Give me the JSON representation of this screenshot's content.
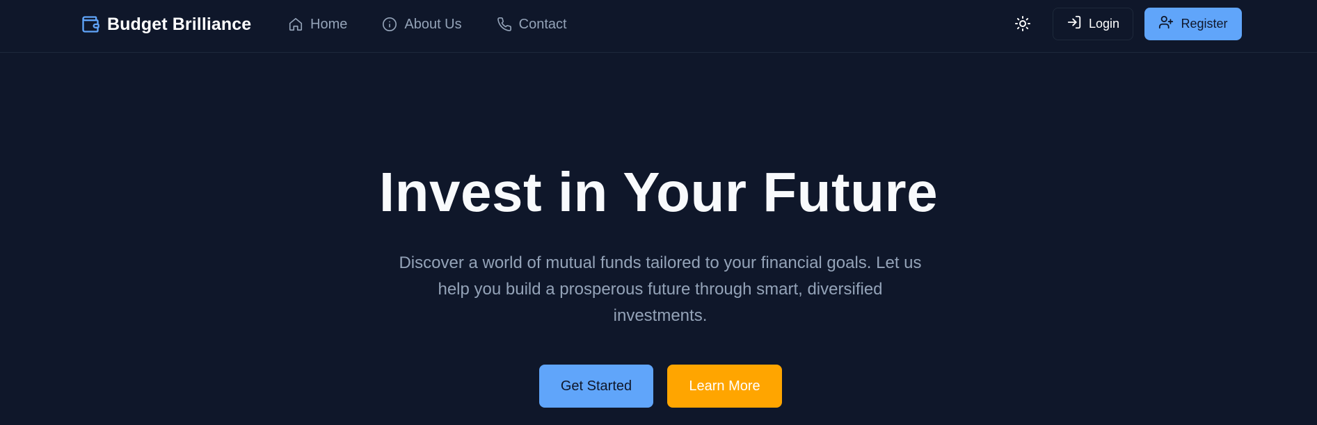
{
  "colors": {
    "background": "#0f172a",
    "primary": "#60a5fa",
    "accent": "#ffa500",
    "muted_text": "#94a3b8",
    "heading_text": "#f8fafc"
  },
  "header": {
    "brand": {
      "icon": "wallet-icon",
      "name": "Budget Brilliance"
    },
    "nav": [
      {
        "icon": "home-icon",
        "label": "Home"
      },
      {
        "icon": "info-icon",
        "label": "About Us"
      },
      {
        "icon": "phone-icon",
        "label": "Contact"
      }
    ],
    "theme_toggle_icon": "sun-icon",
    "login": {
      "icon": "login-icon",
      "label": "Login"
    },
    "register": {
      "icon": "user-plus-icon",
      "label": "Register"
    }
  },
  "hero": {
    "title": "Invest in Your Future",
    "subtitle": "Discover a world of mutual funds tailored to your financial goals. Let us help you build a prosperous future through smart, diversified investments.",
    "primary_cta": "Get Started",
    "secondary_cta": "Learn More"
  }
}
